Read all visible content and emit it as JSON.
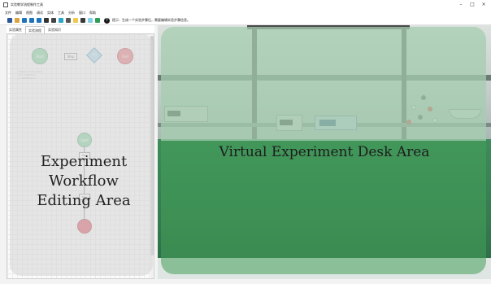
{
  "window": {
    "title": "实验教学流程制作工具",
    "controls": {
      "minimize": "–",
      "maximize": "□",
      "close": "×"
    }
  },
  "menu": [
    "文件",
    "编辑",
    "视图",
    "调试",
    "实体",
    "工具",
    "分析",
    "窗口",
    "帮助"
  ],
  "toolbar": {
    "buttons": [
      {
        "icon": "new-file-icon",
        "color": "#2b5797"
      },
      {
        "icon": "open-folder-icon",
        "color": "#d9a441"
      },
      {
        "icon": "undo-icon",
        "color": "#1e73be"
      },
      {
        "icon": "redo-icon",
        "color": "#1e73be"
      },
      {
        "icon": "save-icon",
        "color": "#1e73be"
      },
      {
        "icon": "dark-square-icon",
        "color": "#333333"
      },
      {
        "icon": "settings-icon",
        "color": "#444444"
      },
      {
        "icon": "cyan-tile-icon",
        "color": "#2aa6c7"
      },
      {
        "icon": "layout-icon",
        "color": "#555555"
      },
      {
        "icon": "yellow-tile-icon",
        "color": "#f0c84a"
      },
      {
        "icon": "dark-tile-icon",
        "color": "#3a3a3a"
      },
      {
        "icon": "highlight-tile-icon",
        "color": "#7fd0e8"
      },
      {
        "icon": "green-tile-icon",
        "color": "#2f9d55"
      }
    ],
    "hint": "提示：生成一个实验步骤后，需要编辑实验步骤信息。"
  },
  "left_panel": {
    "tabs": [
      "实验属性",
      "实验流程",
      "实验知识"
    ],
    "active_tab": 1,
    "palette": {
      "start": "Start",
      "step": "Step",
      "decision": "???",
      "end": "End"
    },
    "info_lines": [
      "Step9: 2.5 minutes",
      "ain: 0.0003 m",
      "s: 1000000.0"
    ],
    "flow": {
      "start": "Start",
      "steps": [
        "Step",
        "Step"
      ]
    },
    "caption": [
      "Experiment",
      "Workflow",
      "Editing Area"
    ]
  },
  "right_panel": {
    "caption": "Virtual Experiment Desk Area"
  }
}
